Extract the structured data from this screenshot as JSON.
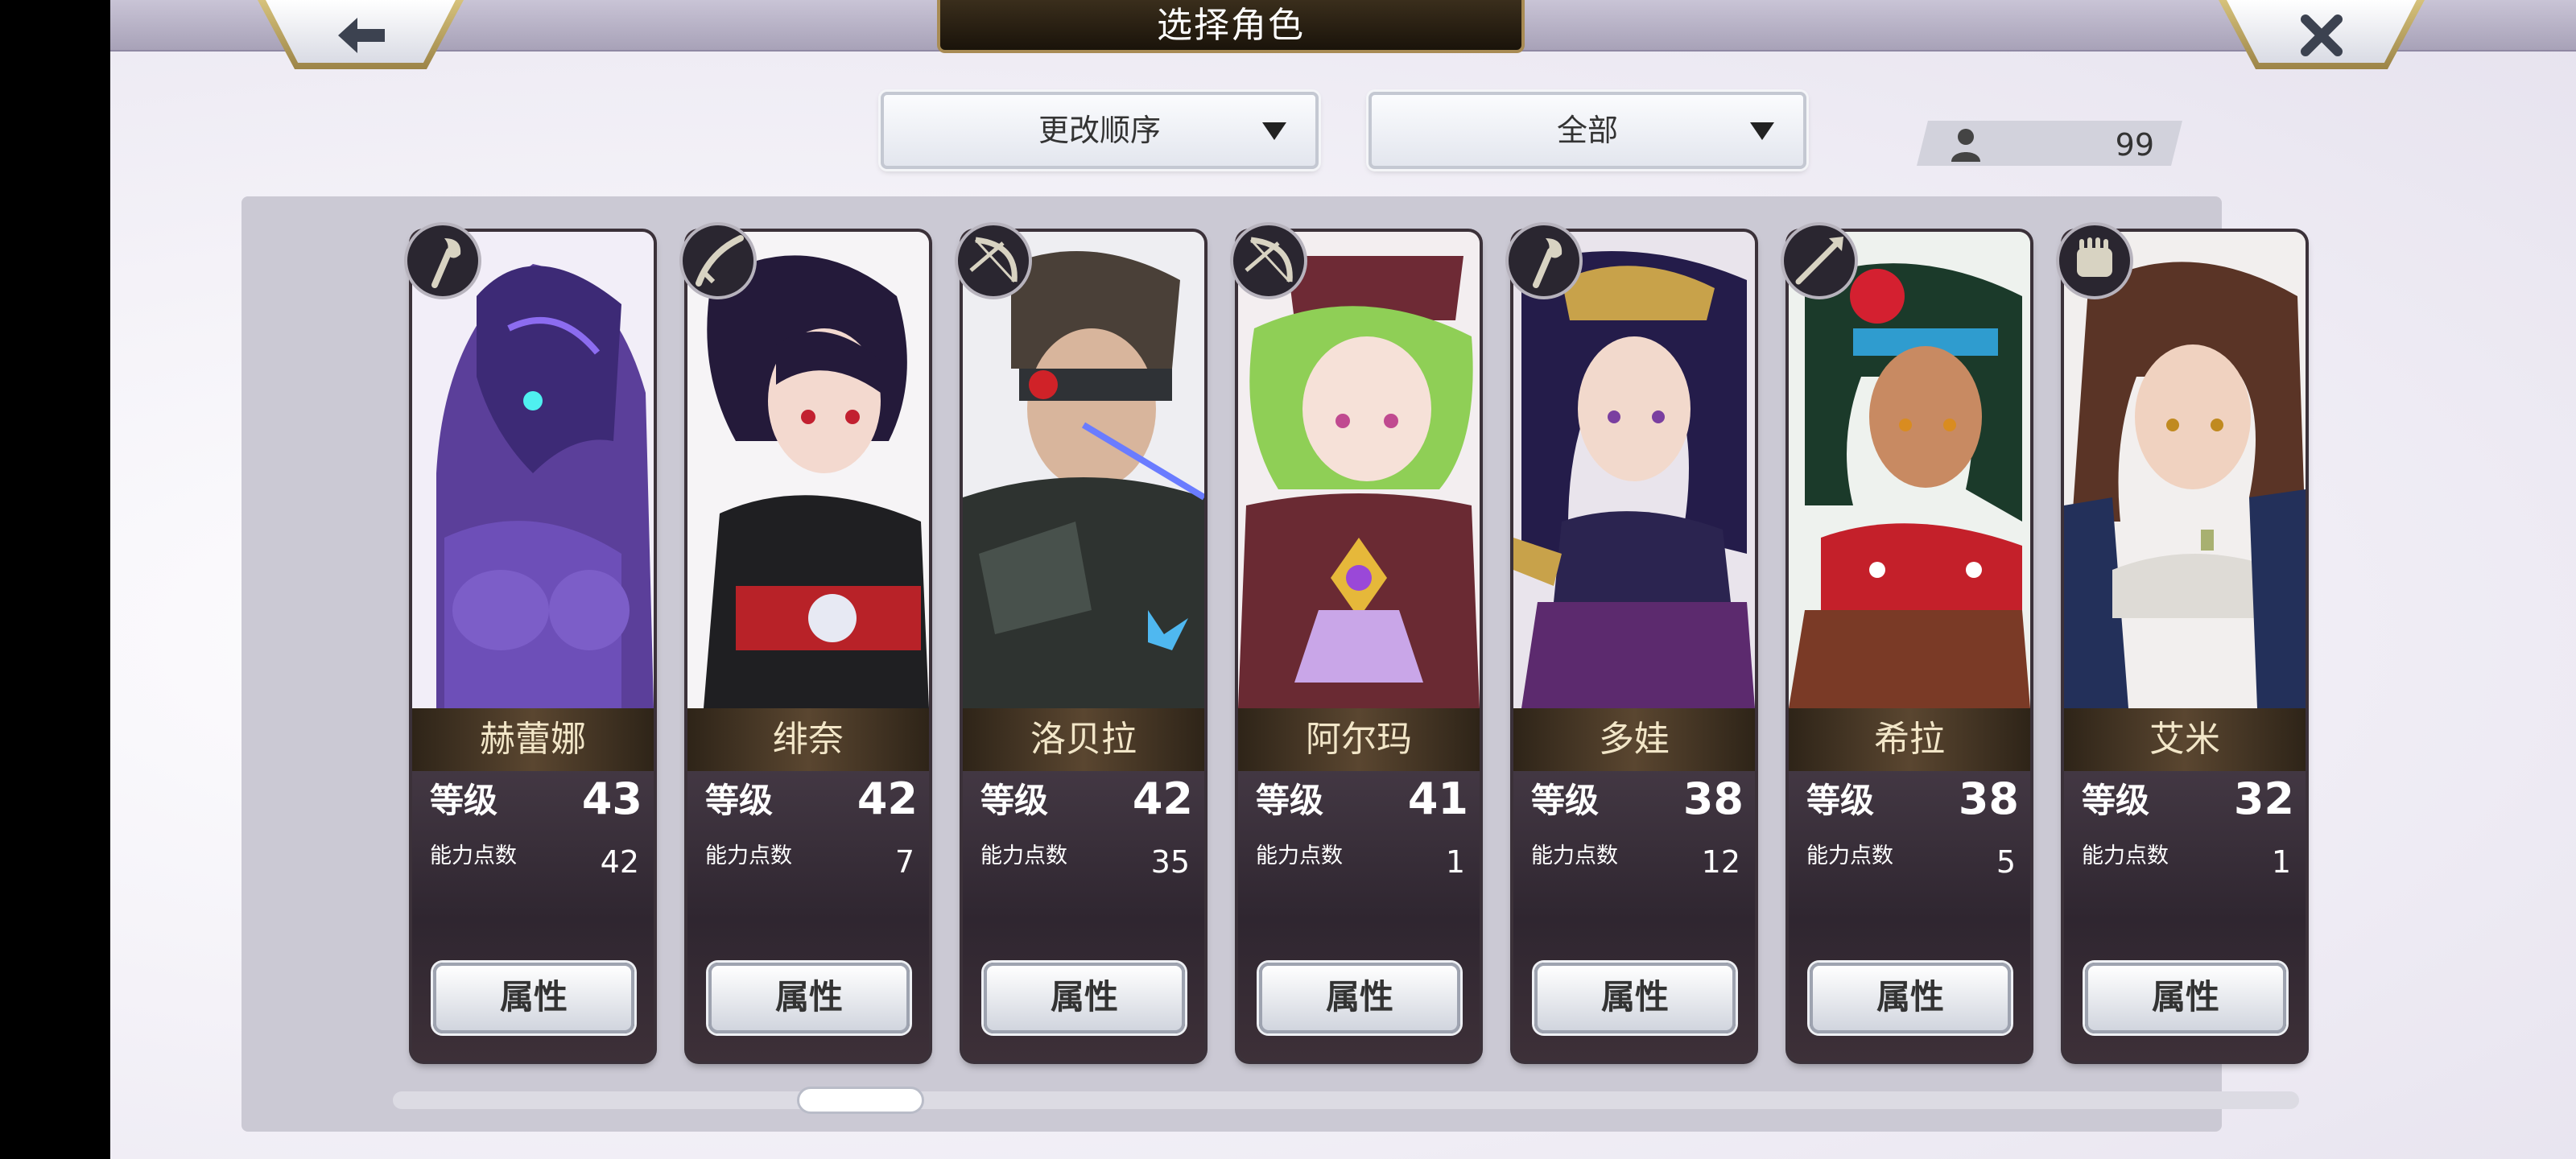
{
  "header": {
    "title": "选择角色",
    "back_icon": "arrow-left-icon",
    "close_icon": "close-x-icon"
  },
  "filters": {
    "sort_label": "更改顺序",
    "category_label": "全部"
  },
  "roster": {
    "count_icon": "person-icon",
    "count": "99"
  },
  "cards": [
    {
      "name": "赫蕾娜",
      "level_label": "等级",
      "level": "43",
      "points_label": "能力点数",
      "points": "42",
      "button": "属性",
      "class_icon": "staff-icon"
    },
    {
      "name": "绯奈",
      "level_label": "等级",
      "level": "42",
      "points_label": "能力点数",
      "points": "7",
      "button": "属性",
      "class_icon": "katana-icon"
    },
    {
      "name": "洛贝拉",
      "level_label": "等级",
      "level": "42",
      "points_label": "能力点数",
      "points": "35",
      "button": "属性",
      "class_icon": "bow-icon"
    },
    {
      "name": "阿尔玛",
      "level_label": "等级",
      "level": "41",
      "points_label": "能力点数",
      "points": "1",
      "button": "属性",
      "class_icon": "bow-icon"
    },
    {
      "name": "多娃",
      "level_label": "等级",
      "level": "38",
      "points_label": "能力点数",
      "points": "12",
      "button": "属性",
      "class_icon": "staff-icon"
    },
    {
      "name": "希拉",
      "level_label": "等级",
      "level": "38",
      "points_label": "能力点数",
      "points": "5",
      "button": "属性",
      "class_icon": "spear-icon"
    },
    {
      "name": "艾米",
      "level_label": "等级",
      "level": "32",
      "points_label": "能力点数",
      "points": "1",
      "button": "属性",
      "class_icon": "gauntlet-icon"
    }
  ],
  "colors": {
    "card_frame": "#3b3139",
    "name_text": "#f2e6c8",
    "accent_gold": "#a88b54"
  }
}
